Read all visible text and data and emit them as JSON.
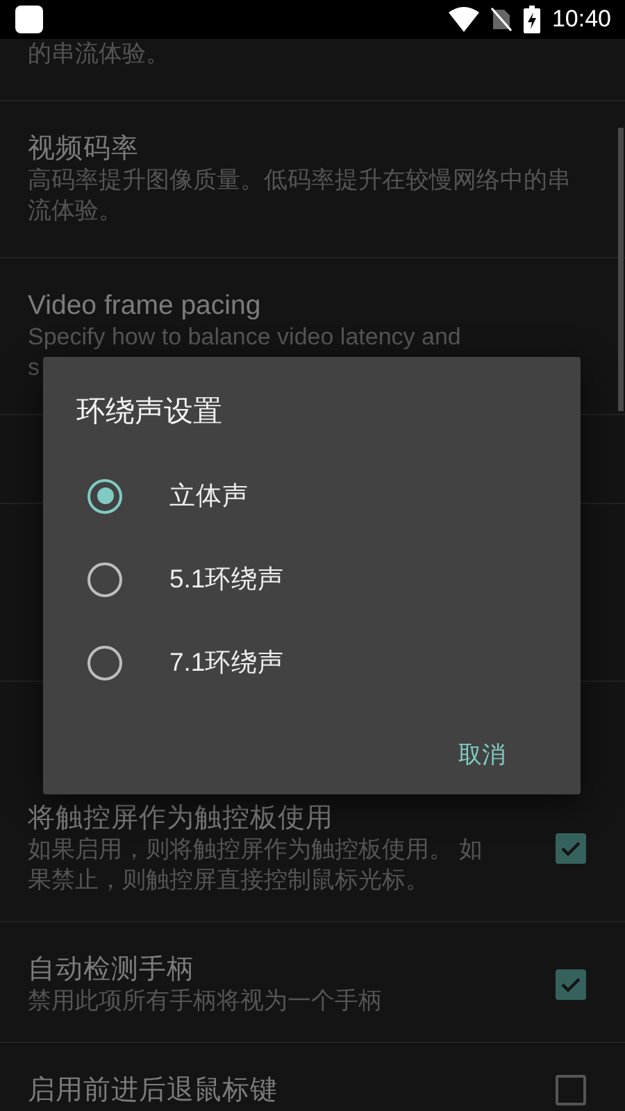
{
  "status_bar": {
    "time": "10:40"
  },
  "settings": [
    {
      "kind": "preference",
      "summary": "的串流体验。"
    },
    {
      "kind": "preference",
      "title": "视频码率",
      "summary": "高码率提升图像质量。低码率提升在较慢网络中的串流体验。"
    },
    {
      "kind": "preference",
      "title": "Video frame pacing",
      "summary": "Specify how to balance video latency and\ns"
    },
    {
      "kind": "preference"
    },
    {
      "kind": "category"
    },
    {
      "kind": "preference"
    },
    {
      "kind": "category"
    },
    {
      "kind": "preference",
      "title": "将触控屏作为触控板使用",
      "summary": "如果启用，则将触控屏作为触控板使用。 如果禁止，则触控屏直接控制鼠标光标。",
      "checked": true
    },
    {
      "kind": "preference",
      "title": "自动检测手柄",
      "summary": "禁用此项所有手柄将视为一个手柄",
      "checked": true
    },
    {
      "kind": "preference",
      "title": "启用前进后退鼠标键",
      "checked": false
    }
  ],
  "dialog": {
    "title": "环绕声设置",
    "options": [
      {
        "label": "立体声",
        "selected": true
      },
      {
        "label": "5.1环绕声",
        "selected": false
      },
      {
        "label": "7.1环绕声",
        "selected": false
      }
    ],
    "buttons": [
      "取消"
    ]
  }
}
